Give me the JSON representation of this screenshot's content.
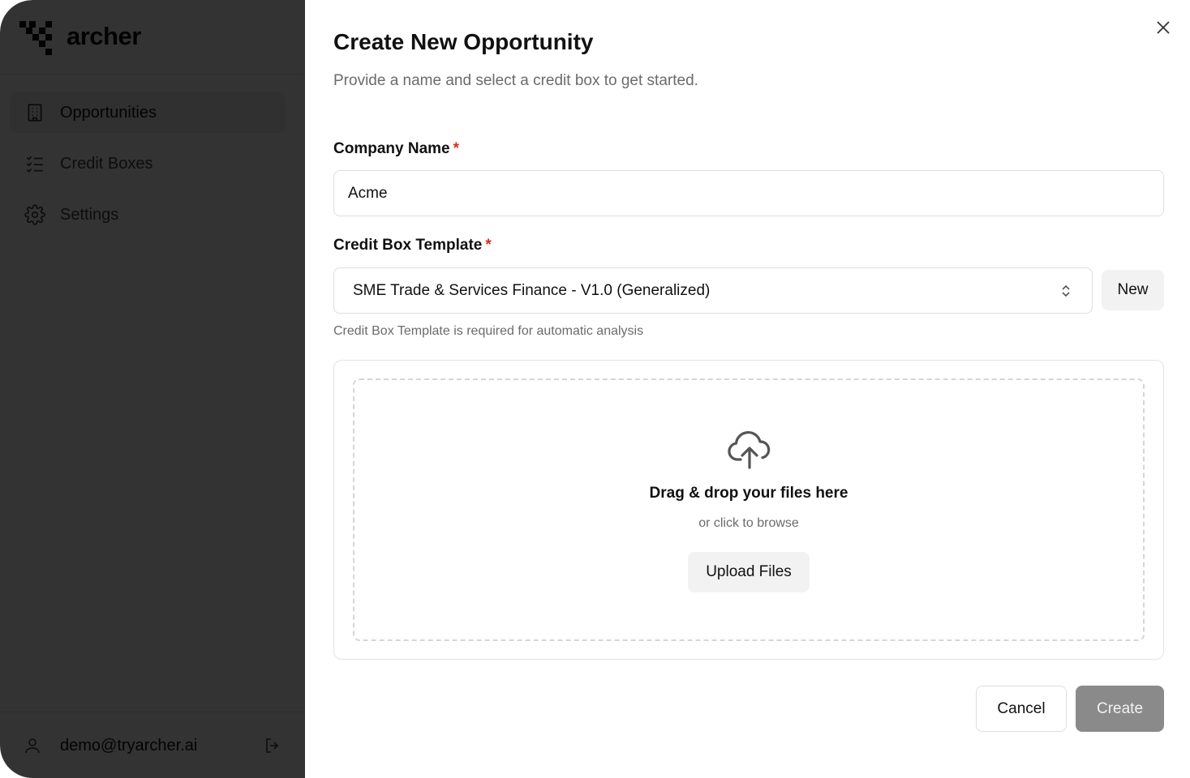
{
  "brand": {
    "name": "archer"
  },
  "sidebar": {
    "items": [
      {
        "label": "Opportunities",
        "icon": "building-icon",
        "active": true
      },
      {
        "label": "Credit Boxes",
        "icon": "checklist-icon",
        "active": false
      },
      {
        "label": "Settings",
        "icon": "gear-icon",
        "active": false
      }
    ],
    "user": {
      "email": "demo@tryarcher.ai"
    }
  },
  "modal": {
    "title": "Create New Opportunity",
    "subtitle": "Provide a name and select a credit box to get started.",
    "company_name": {
      "label": "Company Name",
      "required_marker": "*",
      "value": "Acme"
    },
    "credit_box": {
      "label": "Credit Box Template",
      "required_marker": "*",
      "selected": "SME Trade & Services Finance - V1.0 (Generalized)",
      "new_label": "New",
      "helper": "Credit Box Template is required for automatic analysis"
    },
    "upload": {
      "title": "Drag & drop your files here",
      "subtitle": "or click to browse",
      "button_label": "Upload Files"
    },
    "actions": {
      "cancel_label": "Cancel",
      "create_label": "Create"
    }
  },
  "colors": {
    "required": "#d92d20",
    "create_disabled_bg": "#8a8a8a",
    "overlay": "rgba(0,0,0,0.80)"
  }
}
